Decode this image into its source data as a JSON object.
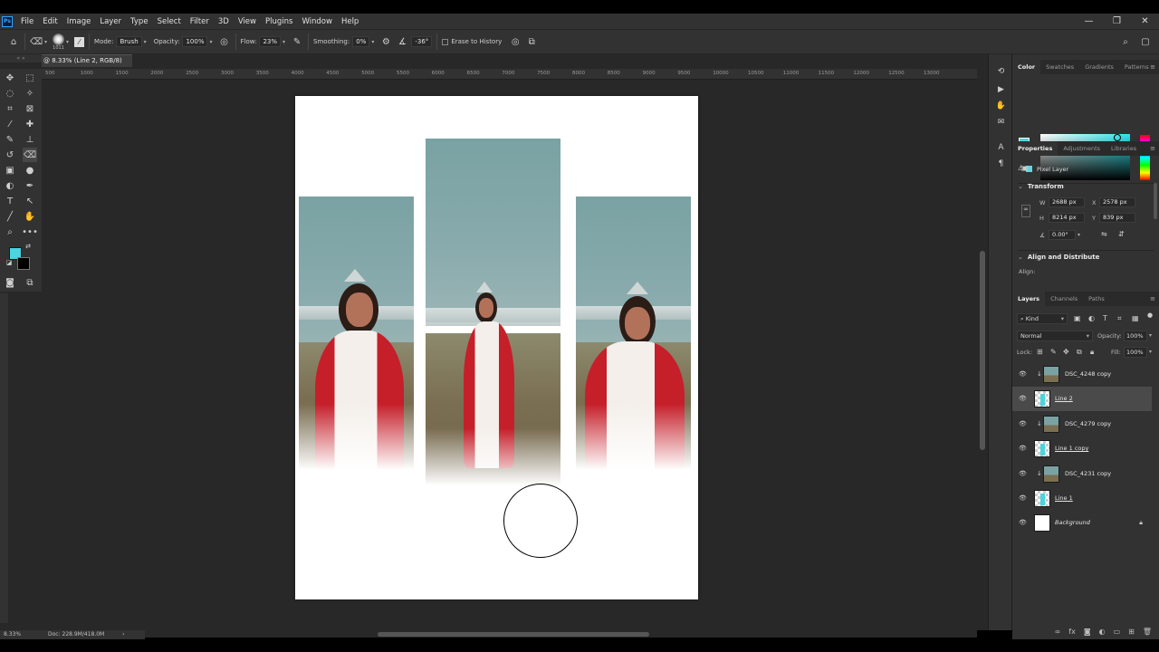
{
  "app": {
    "logo": "Ps",
    "menu": [
      "File",
      "Edit",
      "Image",
      "Layer",
      "Type",
      "Select",
      "Filter",
      "3D",
      "View",
      "Plugins",
      "Window",
      "Help"
    ],
    "window_controls": [
      "—",
      "❐",
      "✕"
    ]
  },
  "options_bar": {
    "brush_size": "1011",
    "mode_label": "Mode:",
    "mode_value": "Brush",
    "opacity_label": "Opacity:",
    "opacity_value": "100%",
    "flow_label": "Flow:",
    "flow_value": "23%",
    "smoothing_label": "Smoothing:",
    "smoothing_value": "0%",
    "angle_value": "-36°",
    "erase_to_history": "Erase to History"
  },
  "document": {
    "tab_title": "@ 8.33% (Line 2, RGB/8) *",
    "zoom": "8.33%",
    "doc_size": "Doc: 228.9M/418.0M"
  },
  "ruler": {
    "h_ticks": [
      "500",
      "1000",
      "1500",
      "2000",
      "2500",
      "3000",
      "3500",
      "4000",
      "4500",
      "5000",
      "5500",
      "6000",
      "6500",
      "7000",
      "7500",
      "8000",
      "8500",
      "9000",
      "9500",
      "10000",
      "10500",
      "11000",
      "11500",
      "12000",
      "12500",
      "13000"
    ]
  },
  "color_panel": {
    "tabs": [
      "Color",
      "Swatches",
      "Gradients",
      "Patterns"
    ],
    "foreground": "#4ad5df",
    "background": "#000000"
  },
  "properties_panel": {
    "tabs": [
      "Properties",
      "Adjustments",
      "Libraries"
    ],
    "layer_type": "Pixel Layer",
    "transform_title": "Transform",
    "w_label": "W",
    "w_value": "2688 px",
    "x_label": "X",
    "x_value": "2578 px",
    "h_label": "H",
    "h_value": "8214 px",
    "y_label": "Y",
    "y_value": "839 px",
    "angle_value": "0.00°",
    "align_title": "Align and Distribute",
    "align_label": "Align:"
  },
  "layers_panel": {
    "tabs": [
      "Layers",
      "Channels",
      "Paths"
    ],
    "filter_kind": "Kind",
    "blend_mode": "Normal",
    "opacity_label": "Opacity:",
    "opacity_value": "100%",
    "lock_label": "Lock:",
    "fill_label": "Fill:",
    "fill_value": "100%",
    "layers": [
      {
        "name": "DSC_4248 copy",
        "type": "photo",
        "clipped": true,
        "selected": false
      },
      {
        "name": "Line 2",
        "type": "line",
        "clipped": false,
        "selected": true
      },
      {
        "name": "DSC_4279 copy",
        "type": "photo",
        "clipped": true,
        "selected": false
      },
      {
        "name": "Line 1 copy",
        "type": "line",
        "clipped": false,
        "selected": false
      },
      {
        "name": "DSC_4231 copy",
        "type": "photo",
        "clipped": true,
        "selected": false
      },
      {
        "name": "Line 1",
        "type": "line",
        "clipped": false,
        "selected": false
      },
      {
        "name": "Background",
        "type": "background",
        "clipped": false,
        "selected": false
      }
    ]
  },
  "colors": {
    "accent_cyan": "#4ad5df",
    "panel_bg": "#323232",
    "workspace_bg": "#282828"
  }
}
